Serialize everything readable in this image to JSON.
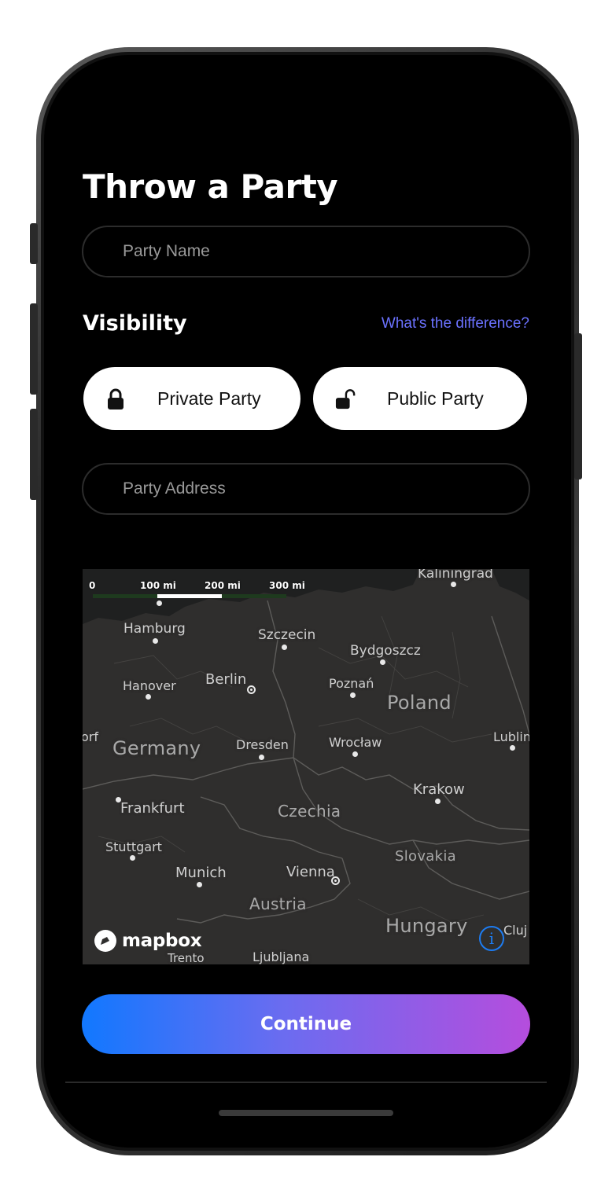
{
  "screen": {
    "title": "Throw a Party"
  },
  "party_name": {
    "placeholder": "Party Name"
  },
  "visibility": {
    "heading": "Visibility",
    "help_link": "What's the difference?",
    "options": [
      {
        "label": "Private Party",
        "icon": "lock-icon"
      },
      {
        "label": "Public Party",
        "icon": "unlock-icon"
      }
    ]
  },
  "party_address": {
    "placeholder": "Party Address"
  },
  "map": {
    "scale": [
      "0",
      "100 mi",
      "200 mi",
      "300 mi"
    ],
    "countries": [
      "Germany",
      "Poland",
      "Czechia",
      "Slovakia",
      "Austria",
      "Hungary"
    ],
    "cities": [
      "Kaliningrad",
      "Hamburg",
      "Szczecin",
      "Bydgoszcz",
      "Hanover",
      "Berlin",
      "Poznań",
      "orf",
      "Dresden",
      "Wrocław",
      "Lublin",
      "Frankfurt",
      "Krakow",
      "Stuttgart",
      "Munich",
      "Vienna",
      "Cluj",
      "Trento",
      "Ljubljana"
    ],
    "attribution": "mapbox",
    "info_glyph": "i"
  },
  "actions": {
    "continue_label": "Continue"
  },
  "colors": {
    "background": "#000000",
    "link": "#6b72ff",
    "gradient_start": "#1178ff",
    "gradient_end": "#b54ddd",
    "map_background": "#2f2e2d"
  }
}
